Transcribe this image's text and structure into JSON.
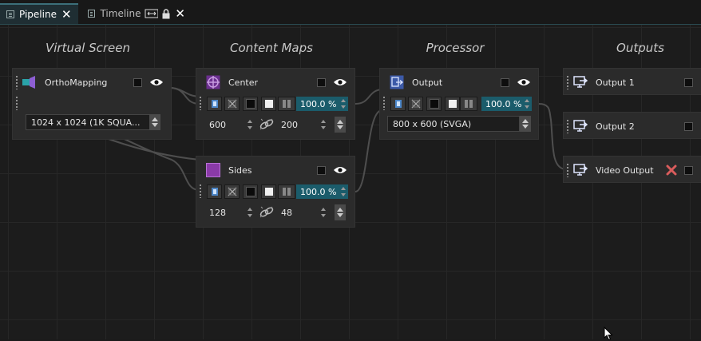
{
  "tabs": [
    {
      "label": "Pipeline",
      "active": true
    },
    {
      "label": "Timeline",
      "active": false
    }
  ],
  "columns": [
    "Virtual Screen",
    "Content Maps",
    "Processor",
    "Outputs"
  ],
  "virtual_screen": {
    "name": "OrthoMapping",
    "resolution": "1024 x 1024    (1K SQUA..."
  },
  "content_maps": [
    {
      "name": "Center",
      "color": "#6b2f8f",
      "opacity": "100.0 %",
      "width": "600",
      "height": "200"
    },
    {
      "name": "Sides",
      "color": "#8a3aa8",
      "opacity": "100.0 %",
      "width": "128",
      "height": "48"
    }
  ],
  "processor": {
    "name": "Output",
    "opacity": "100.0 %",
    "resolution": "800 x 600     (SVGA)"
  },
  "outputs": [
    {
      "name": "Output 1"
    },
    {
      "name": "Output 2"
    },
    {
      "name": "Video Output"
    }
  ],
  "colors": {
    "accent": "#1b5c6b",
    "wire": "#555555",
    "error": "#d95c5c"
  }
}
